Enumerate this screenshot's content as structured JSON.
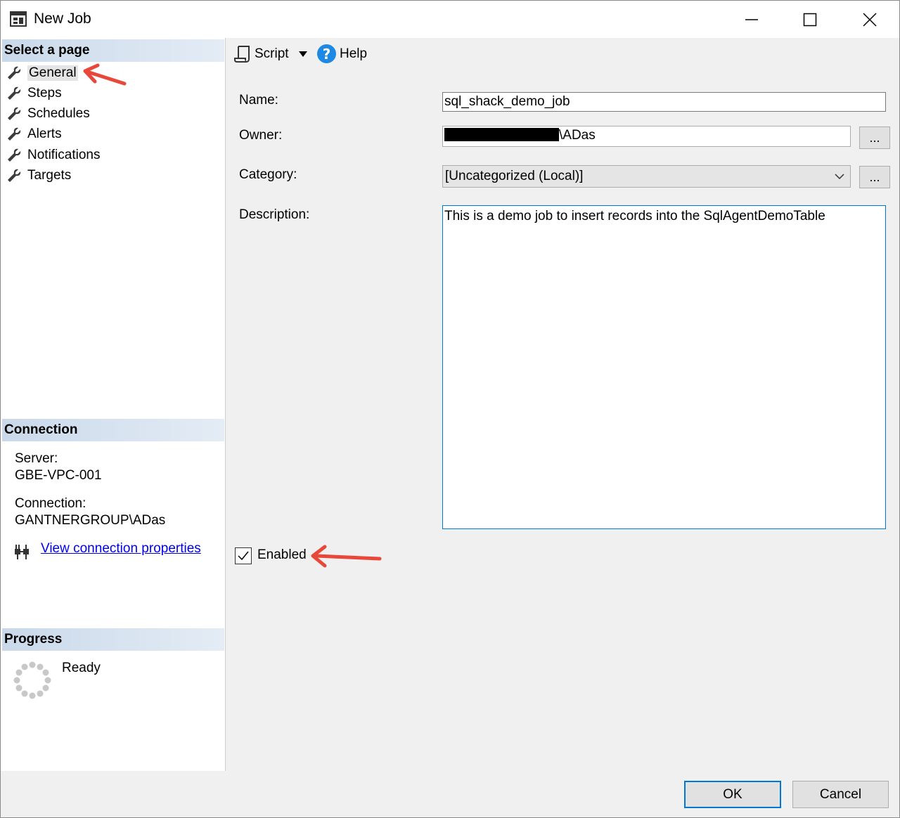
{
  "window": {
    "title": "New Job"
  },
  "left_panel": {
    "select_page_header": "Select a page",
    "pages": [
      {
        "label": "General",
        "selected": true
      },
      {
        "label": "Steps",
        "selected": false
      },
      {
        "label": "Schedules",
        "selected": false
      },
      {
        "label": "Alerts",
        "selected": false
      },
      {
        "label": "Notifications",
        "selected": false
      },
      {
        "label": "Targets",
        "selected": false
      }
    ],
    "connection_header": "Connection",
    "server_label": "Server:",
    "server_value": "GBE-VPC-001",
    "connection_label": "Connection:",
    "connection_value": "GANTNERGROUP\\ADas",
    "view_connection_link": "View connection properties",
    "progress_header": "Progress",
    "progress_status": "Ready"
  },
  "toolbar": {
    "script_label": "Script",
    "help_label": "Help",
    "help_glyph": "?"
  },
  "form": {
    "name_label": "Name:",
    "name_value": "sql_shack_demo_job",
    "owner_label": "Owner:",
    "owner_value_suffix": "\\ADas",
    "category_label": "Category:",
    "category_value": "[Uncategorized (Local)]",
    "description_label": "Description:",
    "description_value": "This is a demo job to insert records into the SqlAgentDemoTable",
    "browse_button": "...",
    "enabled_label": "Enabled",
    "enabled_checked": true
  },
  "footer": {
    "ok_label": "OK",
    "cancel_label": "Cancel"
  },
  "colors": {
    "section_header": "#c9d9ea",
    "focus_border": "#0078d7",
    "link": "#0000ee",
    "annotation_arrow": "#e8483a"
  }
}
